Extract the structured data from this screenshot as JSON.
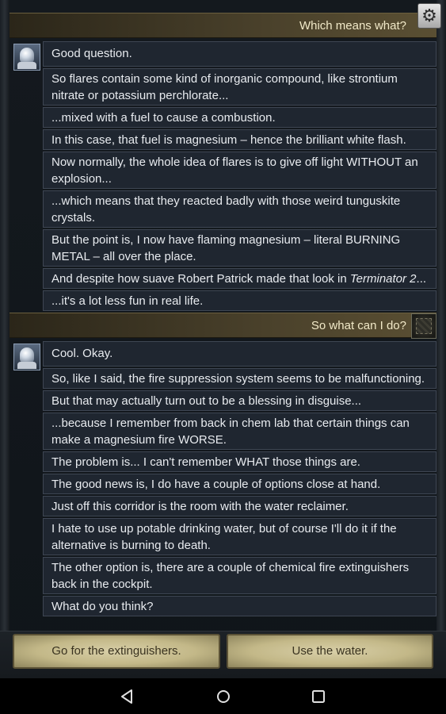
{
  "top_choice": "Which means what?",
  "group1": {
    "messages": [
      {
        "text": "Good question."
      },
      {
        "text": "So flares contain some kind of inorganic compound, like strontium nitrate or potassium perchlorate..."
      },
      {
        "text": "...mixed with a fuel to cause a combustion."
      },
      {
        "text": "In this case, that fuel is magnesium – hence the brilliant white flash."
      },
      {
        "text": "Now normally, the whole idea of flares is to give off light WITHOUT an explosion..."
      },
      {
        "text": "...which means that they reacted badly with those weird tunguskite crystals."
      },
      {
        "text": "But the point is, I now have flaming magnesium – literal BURNING METAL – all over the place."
      },
      {
        "text_before": "And despite how suave Robert Patrick made that look in ",
        "text_italic": "Terminator 2",
        "text_after": "..."
      },
      {
        "text": "...it's a lot less fun in real life."
      }
    ]
  },
  "player_choice_2": "So what can I do?",
  "group2": {
    "messages": [
      {
        "text": "Cool. Okay."
      },
      {
        "text": "So, like I said, the fire suppression system seems to be malfunctioning."
      },
      {
        "text": "But that may actually turn out to be a blessing in disguise..."
      },
      {
        "text": "...because I remember from back in chem lab that certain things can make a magnesium fire WORSE."
      },
      {
        "text": "The problem is... I can't remember WHAT those things are."
      },
      {
        "text": "The good news is, I do have a couple of options close at hand."
      },
      {
        "text": "Just off this corridor is the room with the water reclaimer."
      },
      {
        "text": "I hate to use up potable drinking water, but of course I'll do it if the alternative is burning to death."
      },
      {
        "text": "The other option is, there are a couple of chemical fire extinguishers back in the cockpit."
      },
      {
        "text": "What do you think?"
      }
    ]
  },
  "choices": {
    "option_1": "Go for the extinguishers.",
    "option_2": "Use the water."
  },
  "icons": {
    "settings": "gear-icon",
    "nav_back": "back-triangle-icon",
    "nav_home": "home-circle-icon",
    "nav_recent": "recent-apps-square-icon"
  },
  "colors": {
    "player_bar": "#4a412b",
    "bubble_bg": "#1f2630",
    "choice_bg": "#c3b888"
  }
}
